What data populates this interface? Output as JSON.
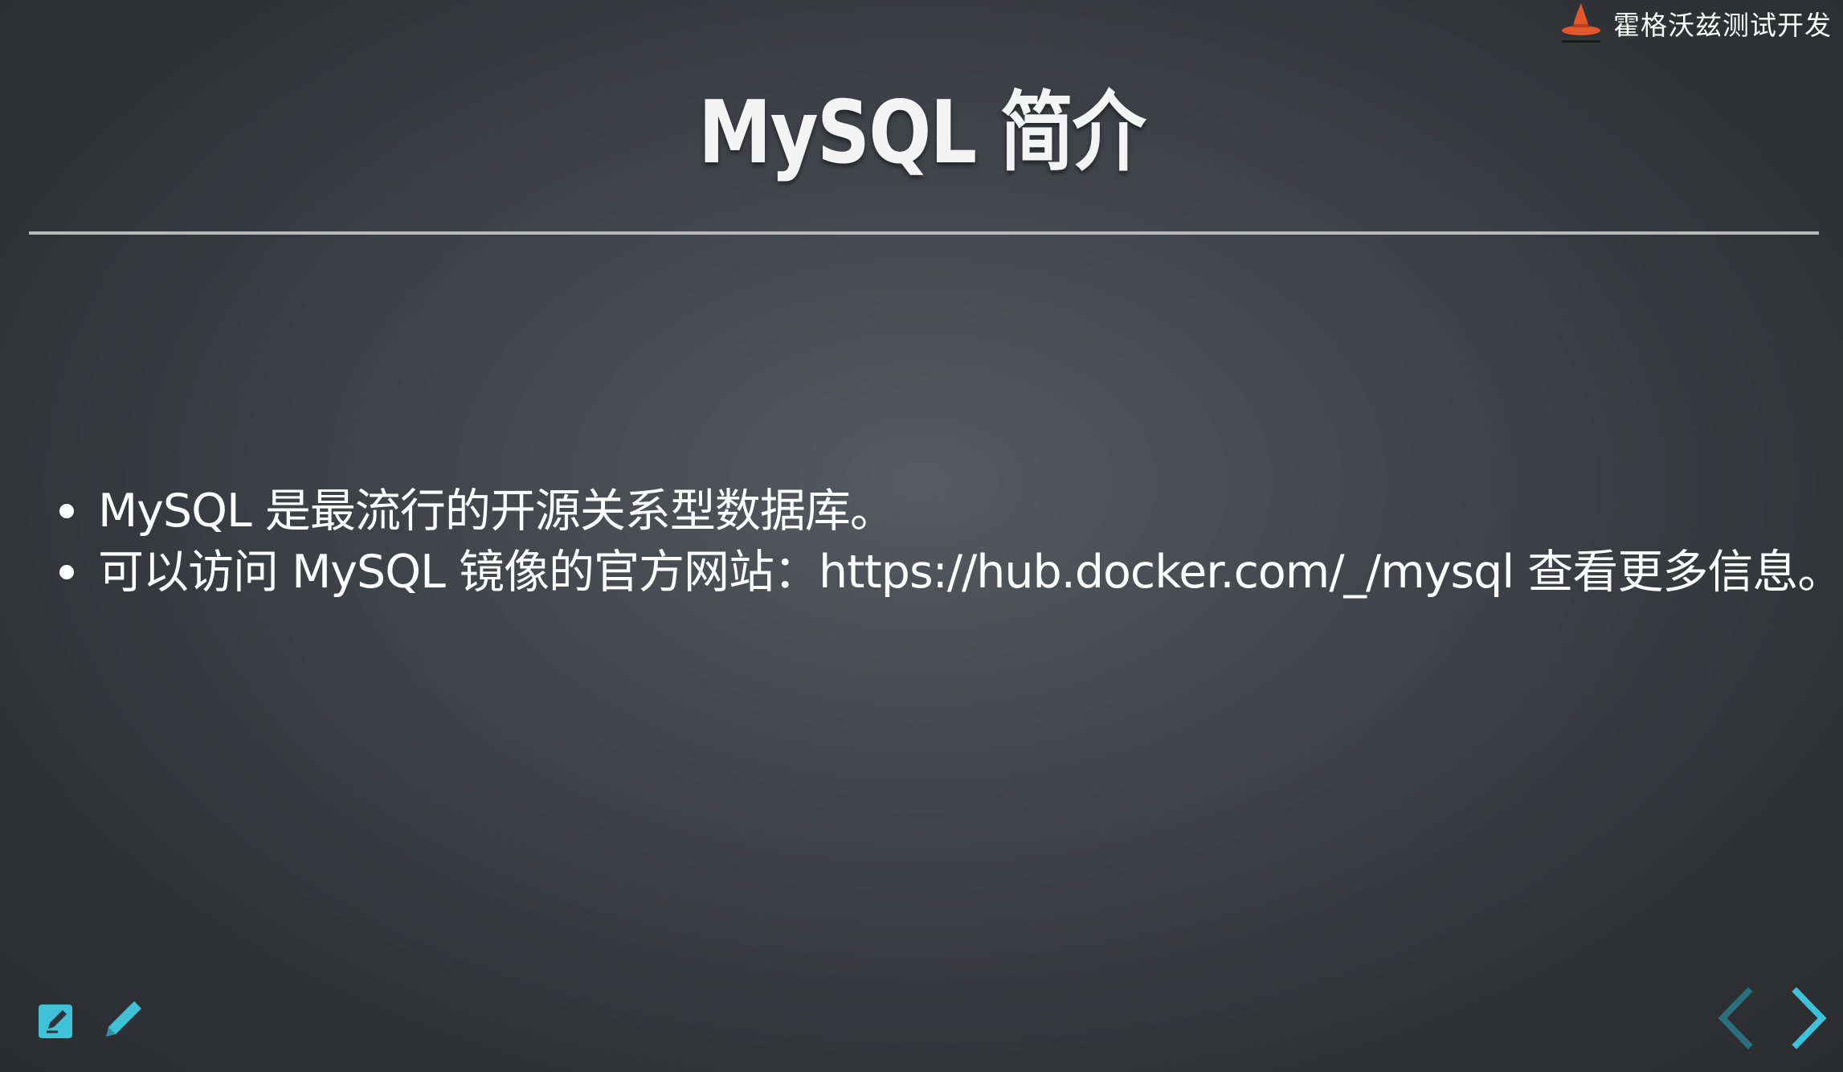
{
  "brand": {
    "name": "霍格沃兹测试开发",
    "logo_icon": "wizard-hat-icon",
    "logo_color": "#e2582c"
  },
  "slide": {
    "title": "MySQL 简介",
    "bullets": [
      "MySQL 是最流行的开源关系型数据库。",
      "可以访问 MySQL 镜像的官方网站：https://hub.docker.com/_/mysql 查看更多信息。"
    ]
  },
  "toolbar": {
    "edit_icon": "edit-slide-icon",
    "pen_icon": "pencil-icon",
    "accent_color": "#3fc1d8"
  },
  "navigation": {
    "prev_icon": "chevron-left-icon",
    "next_icon": "chevron-right-icon",
    "prev_color": "#2a6f7c",
    "next_color": "#3fc1d8"
  }
}
